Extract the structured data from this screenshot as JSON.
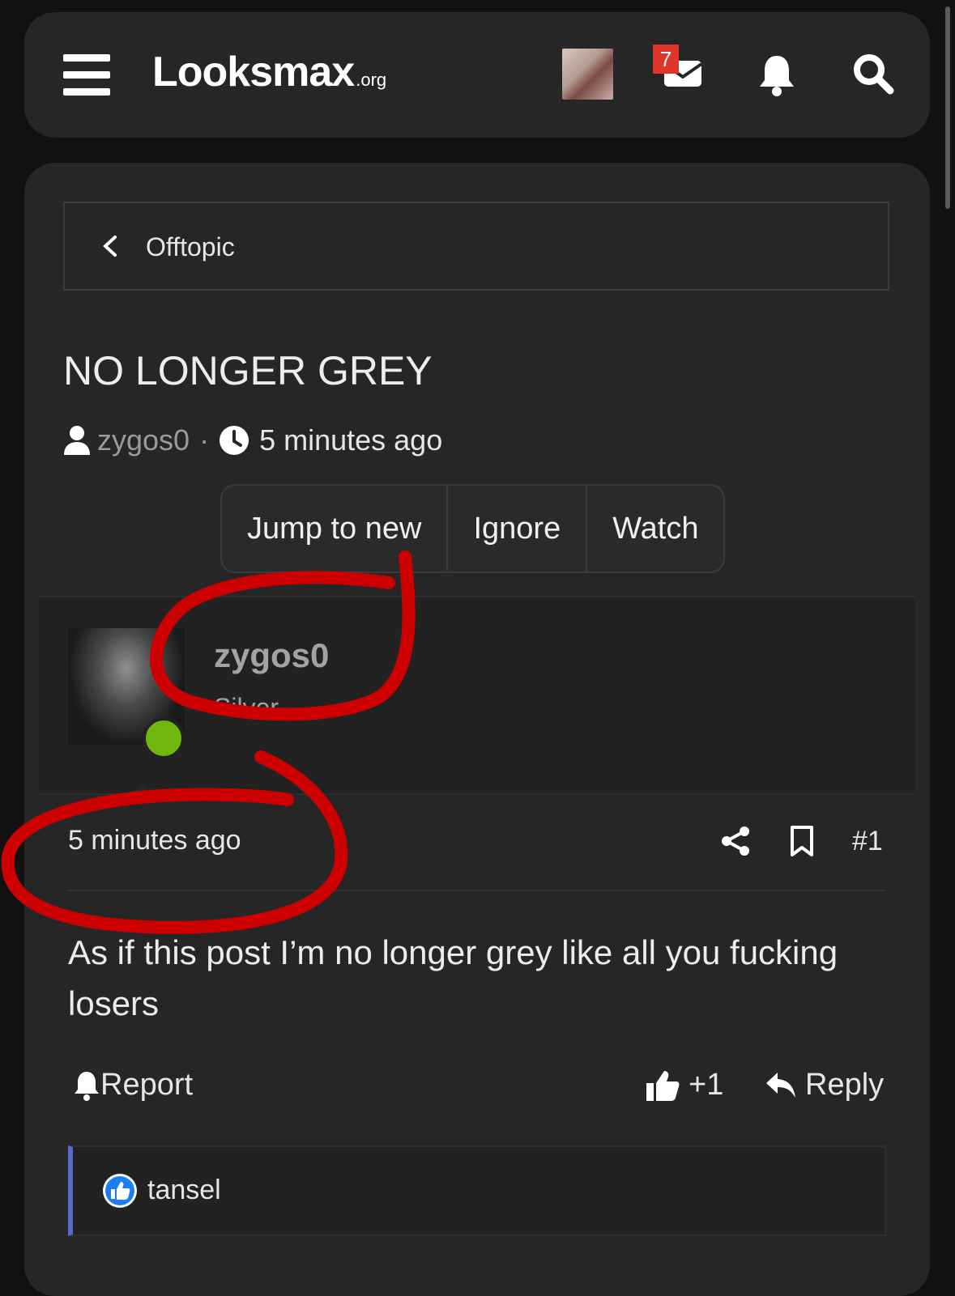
{
  "header": {
    "logo_main": "Looksmax",
    "logo_sub": ".org",
    "mail_badge": "7",
    "icons": [
      "menu-icon",
      "mail-icon",
      "bell-icon",
      "search-icon"
    ]
  },
  "breadcrumb": {
    "label": "Offtopic"
  },
  "thread": {
    "title": "NO LONGER GREY",
    "author": "zygos0",
    "separator": "·",
    "time": "5 minutes ago"
  },
  "actions": {
    "jump": "Jump to new",
    "ignore": "Ignore",
    "watch": "Watch"
  },
  "post": {
    "username": "zygos0",
    "rank": "Silver",
    "time": "5 minutes ago",
    "number": "#1",
    "body": "As if this post I’m no longer grey like all you fucking losers",
    "report": "Report",
    "like_count": "+1",
    "reply": "Reply"
  },
  "reactions": {
    "user": "tansel"
  },
  "colors": {
    "background": "#111111",
    "panel": "#262626",
    "online": "#6fb70a",
    "badge": "#e0352b",
    "annotation": "#cc0000",
    "reaction_accent": "#5b6bc8"
  }
}
